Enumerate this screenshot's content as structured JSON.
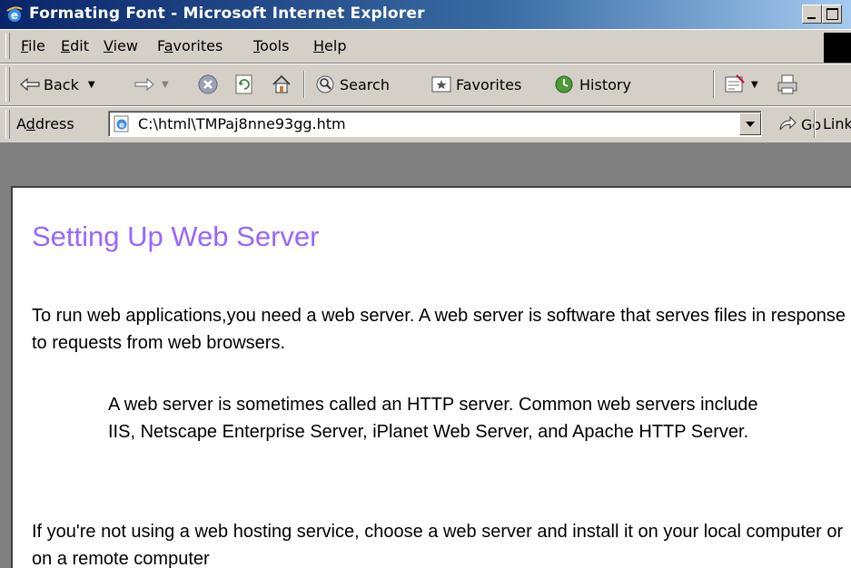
{
  "window": {
    "title": "Formating Font - Microsoft Internet Explorer"
  },
  "menu": {
    "items": [
      {
        "label": "File",
        "mnemonic": "F",
        "rest": "ile"
      },
      {
        "label": "Edit",
        "mnemonic": "E",
        "rest": "dit"
      },
      {
        "label": "View",
        "mnemonic": "V",
        "rest": "iew"
      },
      {
        "label": "Favorites",
        "pre": "F",
        "mnemonic": "a",
        "rest": "vorites"
      },
      {
        "label": "Tools",
        "mnemonic": "T",
        "rest": "ools"
      },
      {
        "label": "Help",
        "mnemonic": "H",
        "rest": "elp"
      }
    ]
  },
  "toolbar": {
    "back_label": "Back",
    "search_label": "Search",
    "favorites_label": "Favorites",
    "history_label": "History",
    "icons": [
      "back-arrow-icon",
      "forward-arrow-icon",
      "stop-icon",
      "refresh-icon",
      "home-icon",
      "search-icon",
      "favorites-icon",
      "history-icon",
      "edit-icon",
      "print-icon"
    ]
  },
  "address": {
    "label_pre": "A",
    "label_mnemonic": "d",
    "label_rest": "dress",
    "url": "C:\\html\\TMPaj8nne93gg.htm",
    "go_label": "Go",
    "links_label": "Link"
  },
  "page": {
    "heading": "Setting Up Web Server",
    "heading_color": "#9966ff",
    "paragraph1": "To run web applications,you need a web server. A web server is software that serves files in response to requests from web browsers.",
    "blockquote": "A web server is sometimes called an HTTP server. Common web servers include IIS, Netscape Enterprise Server, iPlanet Web Server, and Apache HTTP Server.",
    "paragraph3": "If you're not using a web hosting service, choose a web server and install it on your local computer or on a remote computer"
  }
}
